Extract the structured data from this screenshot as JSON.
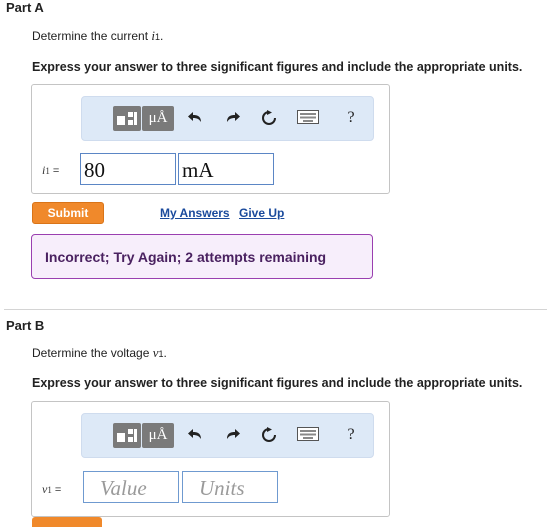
{
  "part_a": {
    "title": "Part A",
    "prompt_text": "Determine the current",
    "prompt_var": "i",
    "prompt_sub": "1",
    "prompt_end": ".",
    "instruction": "Express your answer to three significant figures and include the appropriate units.",
    "toolbar": {
      "units_label": "μÅ",
      "help_label": "?",
      "icons": [
        "templates-icon",
        "units-icon",
        "undo-icon",
        "redo-icon",
        "reset-icon",
        "keyboard-icon",
        "help-icon"
      ]
    },
    "answer_var": "i",
    "answer_sub": "1",
    "equals": "=",
    "value": "80",
    "units": "mA",
    "submit_label": "Submit",
    "my_answers_label": "My Answers",
    "give_up_label": "Give Up",
    "feedback": "Incorrect; Try Again; 2 attempts remaining"
  },
  "part_b": {
    "title": "Part B",
    "prompt_text": "Determine the voltage",
    "prompt_var": "v",
    "prompt_sub": "1",
    "prompt_end": ".",
    "instruction": "Express your answer to three significant figures and include the appropriate units.",
    "toolbar": {
      "units_label": "μÅ",
      "help_label": "?"
    },
    "answer_var": "v",
    "answer_sub": "1",
    "equals": "=",
    "value_placeholder": "Value",
    "units_placeholder": "Units"
  },
  "colors": {
    "submit": "#f0892b",
    "link": "#1a4a9c",
    "feedback_border": "#9a3fb0",
    "toolbar_bg": "#dde9f7"
  }
}
